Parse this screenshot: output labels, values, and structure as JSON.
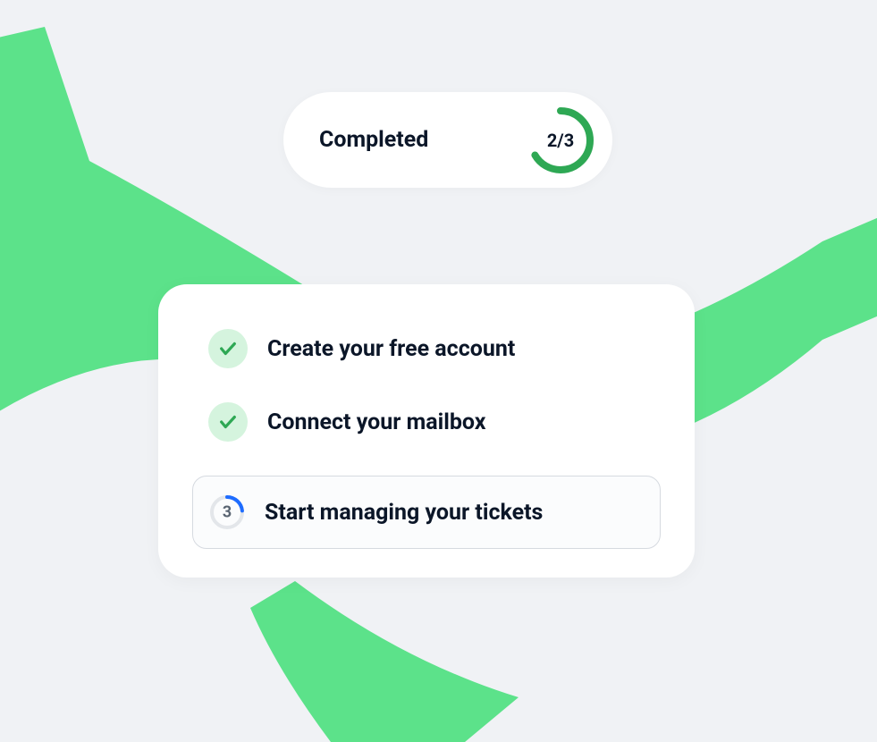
{
  "progress": {
    "label": "Completed",
    "count_text": "2/3",
    "completed": 2,
    "total": 3
  },
  "steps": [
    {
      "label": "Create your free account",
      "done": true
    },
    {
      "label": "Connect your mailbox",
      "done": true
    },
    {
      "label": "Start managing your tickets",
      "done": false,
      "number": "3"
    }
  ],
  "colors": {
    "accent_green": "#3ddc79",
    "check_green": "#2ea854",
    "ring_blue": "#1e6cff"
  }
}
